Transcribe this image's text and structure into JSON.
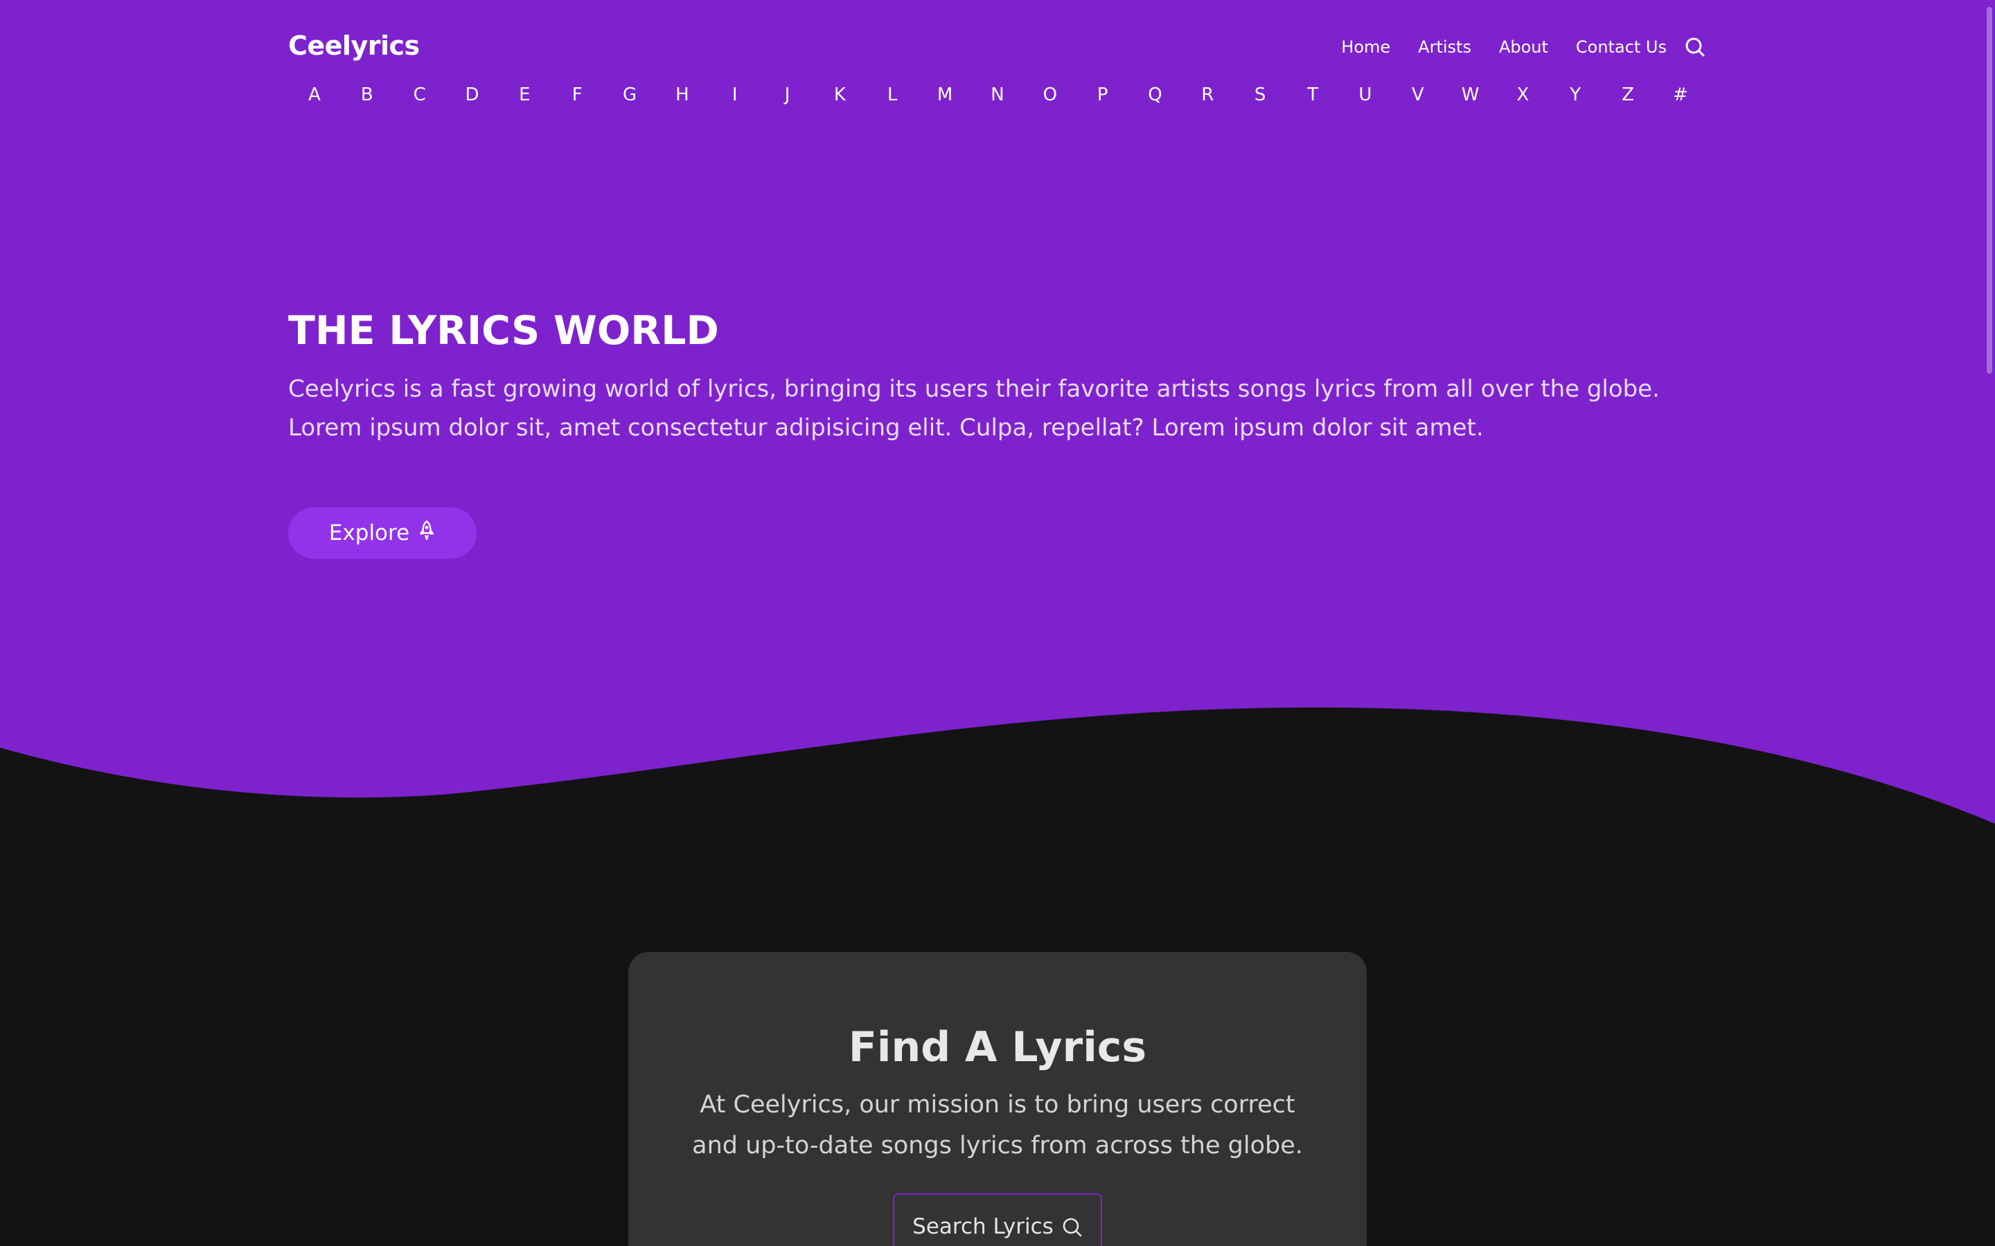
{
  "colors": {
    "hero_purple": "#7e22ce",
    "page_dark": "#131313",
    "card_gray": "#333333",
    "button_purple": "#9233ea"
  },
  "brand": {
    "name": "Ceelyrics"
  },
  "nav": {
    "links": [
      "Home",
      "Artists",
      "About",
      "Contact Us"
    ],
    "search_icon": "search-icon"
  },
  "alphabet": [
    "A",
    "B",
    "C",
    "D",
    "E",
    "F",
    "G",
    "H",
    "I",
    "J",
    "K",
    "L",
    "M",
    "N",
    "O",
    "P",
    "Q",
    "R",
    "S",
    "T",
    "U",
    "V",
    "W",
    "X",
    "Y",
    "Z",
    "#"
  ],
  "hero": {
    "title": "THE LYRICS WORLD",
    "description": "Ceelyrics is a fast growing world of lyrics, bringing its users their favorite artists songs lyrics from all over the globe. Lorem ipsum dolor sit, amet consectetur adipisicing elit. Culpa, repellat? Lorem ipsum dolor sit amet.",
    "explore_label": "Explore",
    "explore_icon": "rocket-icon"
  },
  "find": {
    "title": "Find A Lyrics",
    "description": "At Ceelyrics, our mission is to bring users correct and up-to-date songs lyrics from across the globe.",
    "button_label": "Search Lyrics",
    "button_icon": "search-icon"
  }
}
